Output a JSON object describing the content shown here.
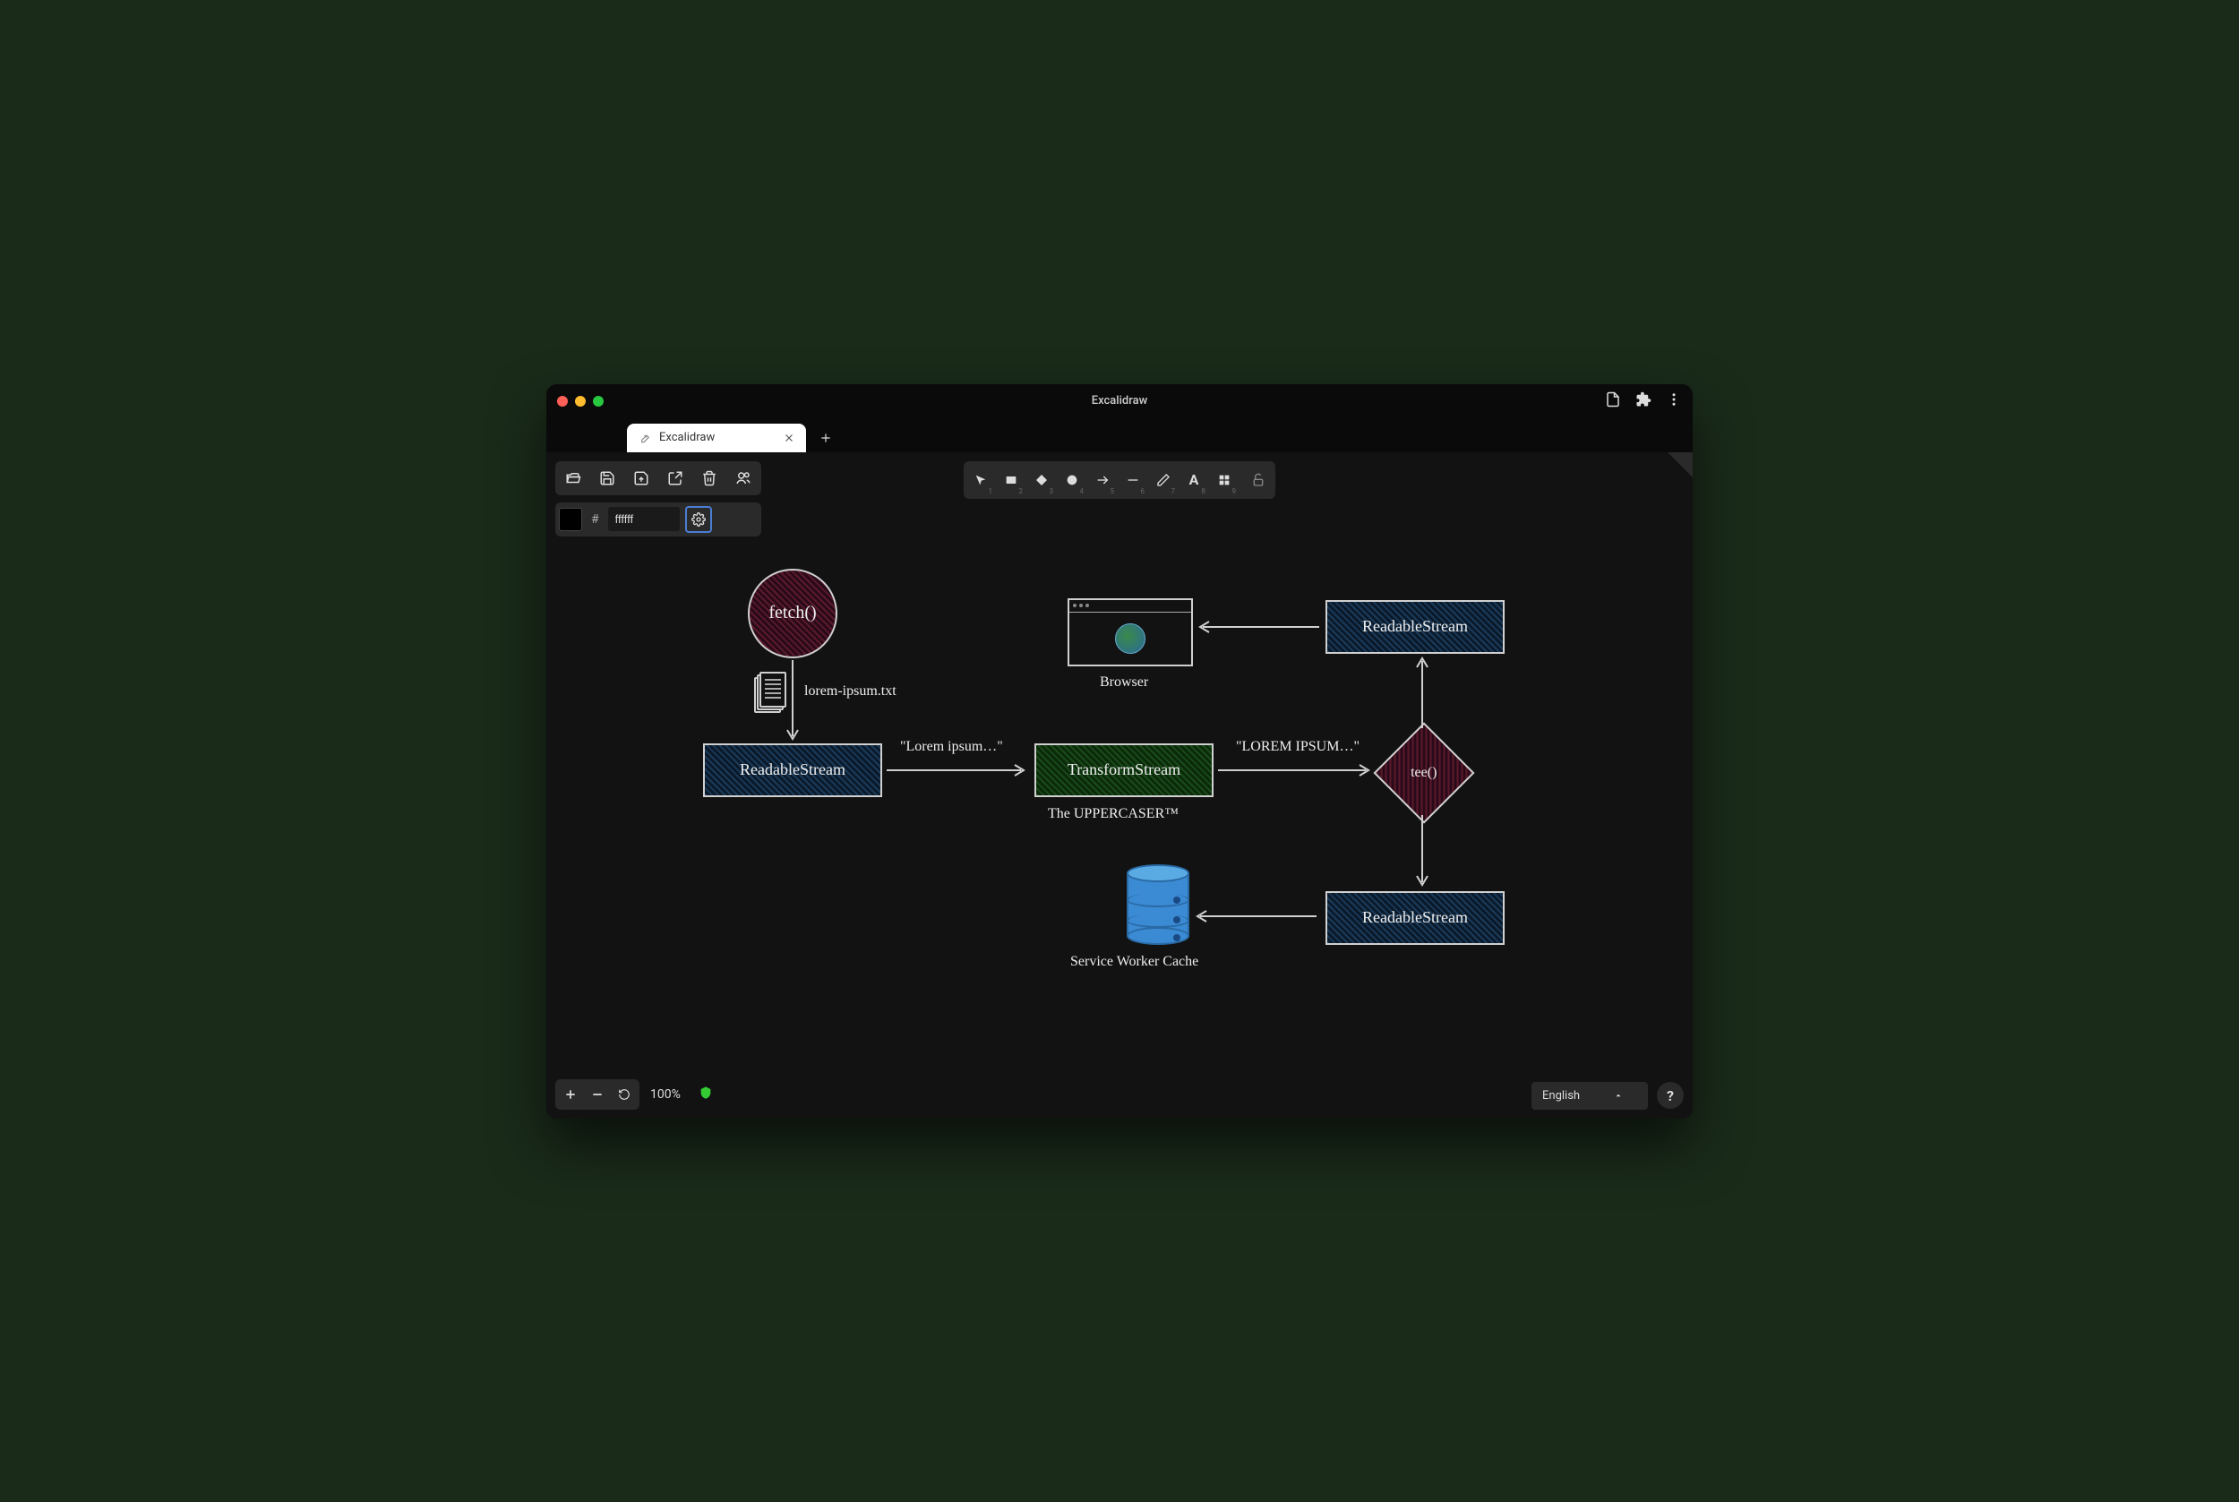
{
  "window": {
    "title": "Excalidraw"
  },
  "tab": {
    "title": "Excalidraw"
  },
  "color": {
    "value": "ffffff"
  },
  "tools": {
    "numbers": {
      "select": "1",
      "rect": "2",
      "diamond": "3",
      "circle": "4",
      "arrow": "5",
      "line": "6",
      "pencil": "7",
      "text": "8",
      "image": "9"
    }
  },
  "zoom": {
    "label": "100%"
  },
  "language": {
    "label": "English"
  },
  "diagram": {
    "fetch": "fetch()",
    "file": "lorem-ipsum.txt",
    "readable1": "ReadableStream",
    "transform": "TransformStream",
    "uppercaser": "The UPPERCASER™",
    "lorem_lower": "\"Lorem ipsum…\"",
    "lorem_upper": "\"LOREM IPSUM…\"",
    "tee": "tee()",
    "readable2": "ReadableStream",
    "readable3": "ReadableStream",
    "browser": "Browser",
    "swcache": "Service Worker Cache"
  }
}
